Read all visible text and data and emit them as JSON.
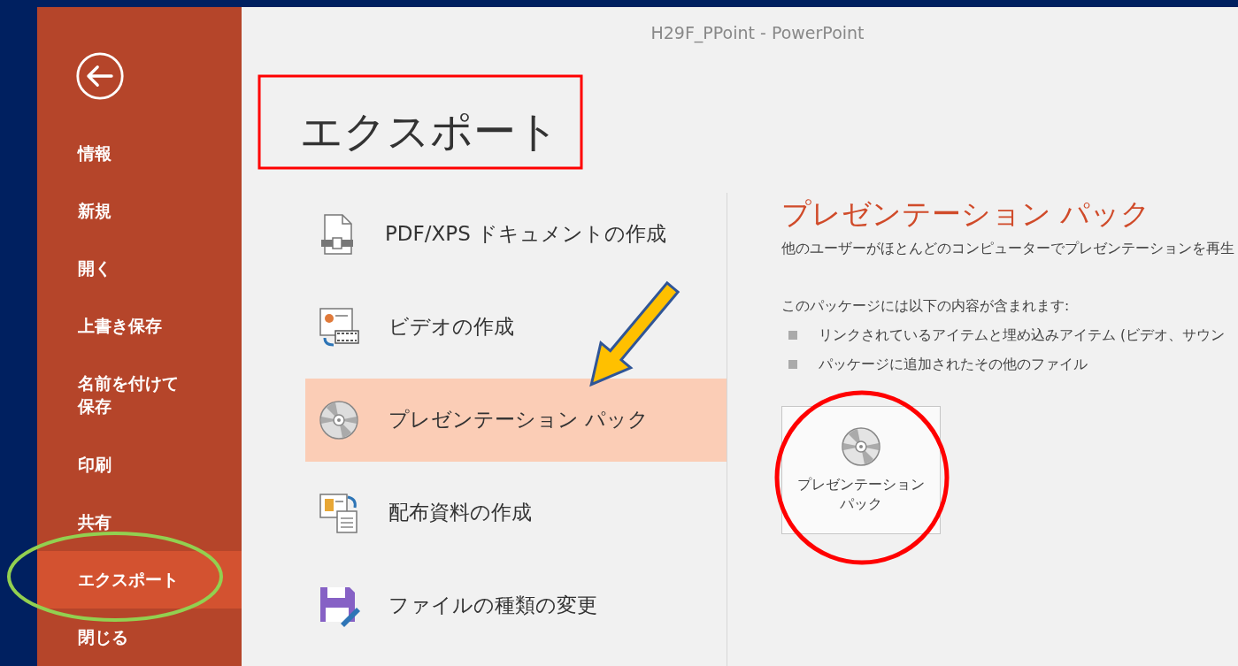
{
  "window": {
    "title": "H29F_PPoint - PowerPoint"
  },
  "sidebar": {
    "items": [
      {
        "label": "情報",
        "selected": false
      },
      {
        "label": "新規",
        "selected": false
      },
      {
        "label": "開く",
        "selected": false
      },
      {
        "label": "上書き保存",
        "selected": false
      },
      {
        "label": "名前を付けて保存",
        "selected": false
      },
      {
        "label": "印刷",
        "selected": false
      },
      {
        "label": "共有",
        "selected": false
      },
      {
        "label": "エクスポート",
        "selected": true
      },
      {
        "label": "閉じる",
        "selected": false
      }
    ]
  },
  "heading": "エクスポート",
  "export_options": [
    {
      "label": "PDF/XPS ドキュメントの作成",
      "kind": "pdf",
      "selected": false
    },
    {
      "label": "ビデオの作成",
      "kind": "video",
      "selected": false
    },
    {
      "label": "プレゼンテーション パック",
      "kind": "cd",
      "selected": true
    },
    {
      "label": "配布資料の作成",
      "kind": "handout",
      "selected": false
    },
    {
      "label": "ファイルの種類の変更",
      "kind": "filetype",
      "selected": false
    }
  ],
  "detail": {
    "title": "プレゼンテーション パック",
    "description": "他のユーザーがほとんどのコンピューターでプレゼンテーションを再生",
    "contents_heading": "このパッケージには以下の内容が含まれます:",
    "bullets": [
      "リンクされているアイテムと埋め込みアイテム (ビデオ、サウン",
      "パッケージに追加されたその他のファイル"
    ],
    "button_lines": [
      "プレゼンテーション",
      "パック"
    ]
  },
  "annotations": [
    {
      "kind": "rectangle",
      "color": "#ff0000"
    },
    {
      "kind": "arrow",
      "color": "#ffc000"
    },
    {
      "kind": "circle",
      "color": "#ff0000"
    },
    {
      "kind": "ellipse",
      "color": "#92d050"
    }
  ]
}
